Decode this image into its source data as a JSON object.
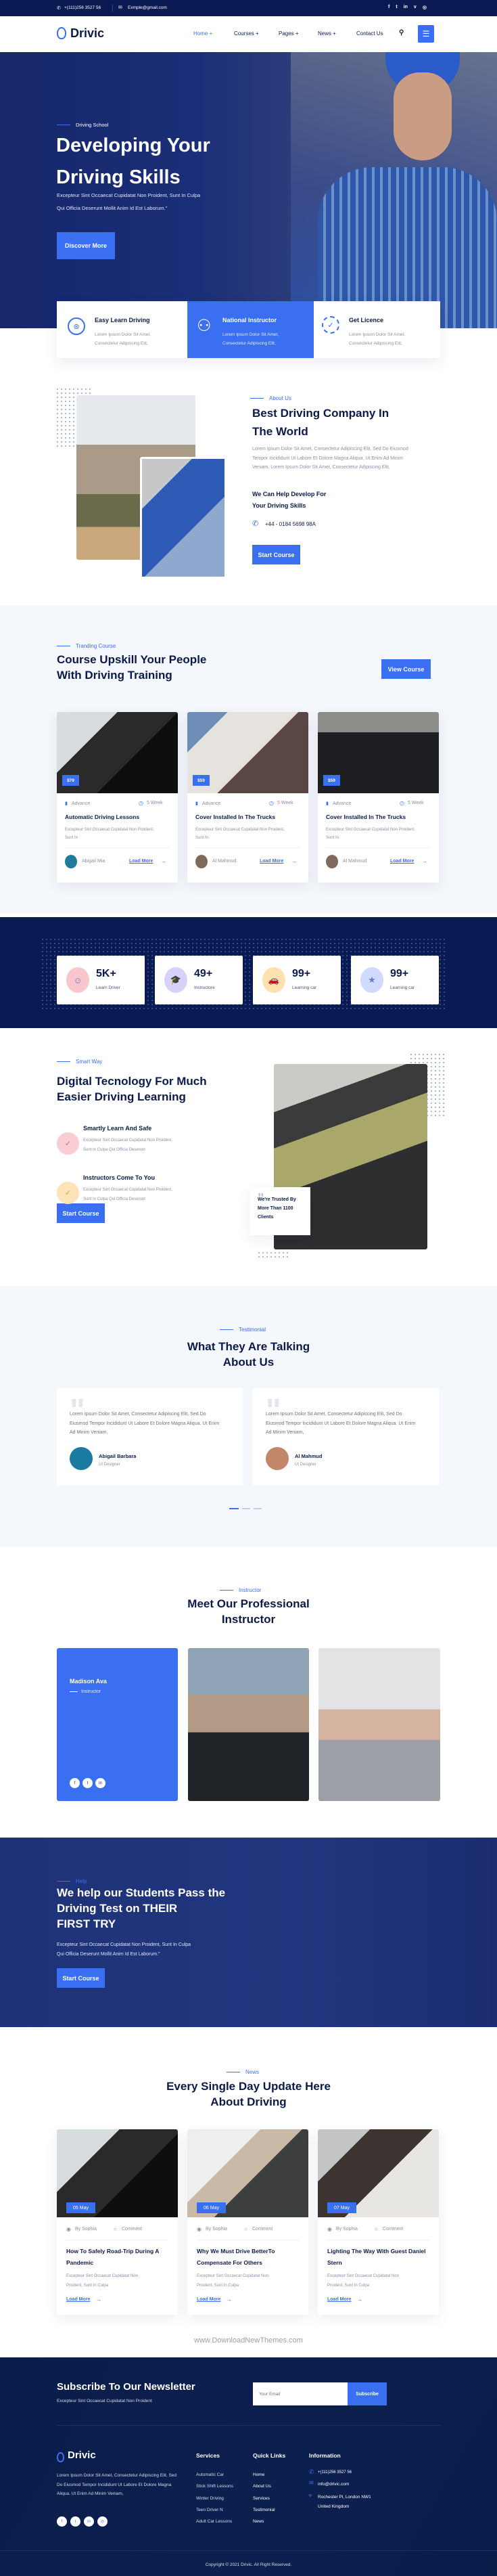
{
  "topbar": {
    "phone": "+(111)256 3527 56",
    "email": "Exmple@gmail.com",
    "social_icons": [
      "facebook-icon",
      "twitter-icon",
      "linkedin-icon",
      "vimeo-icon",
      "instagram-icon"
    ]
  },
  "nav": {
    "logo": "Drivic",
    "items": [
      "Home +",
      "Courses +",
      "Pages +",
      "News +",
      "Contact Us"
    ],
    "active_index": 0
  },
  "hero": {
    "eyebrow": "Driving School",
    "title_line1": "Developing Your",
    "title_line2": "Driving Skills",
    "text_line1": "Excepteur Sint Occaecat Cupidatat Non Proident, Sunt In Culpa",
    "text_line2": "Qui Officia Deserunt Mollit Anim Id Est Laborum.\"",
    "button": "Discover More"
  },
  "features": [
    {
      "title": "Easy Learn Driving",
      "text1": "Lorem Ipsum Dolor Sit Amet,",
      "text2": "Consectetur Adipiscing Elit,",
      "icon": "steering-wheel-icon"
    },
    {
      "title": "National Instructor",
      "text1": "Lorem Ipsum Dolor Sit Amet,",
      "text2": "Consectetur Adipiscing Elit,",
      "icon": "instructor-icon"
    },
    {
      "title": "Get Licence",
      "text1": "Lorem Ipsum Dolor Sit Amet,",
      "text2": "Consectetur Adipiscing Elit,",
      "icon": "badge-check-icon"
    }
  ],
  "about": {
    "eyebrow": "About Us",
    "title_line1": "Best Driving Company In",
    "title_line2": "The World",
    "text": "Lorem Ipsum Dolor Sit Amet, Consectetur Adipiscing Elit, Sed Do Eiusmod Tempor Incididunt Ut Labore Et Dolore Magna Aliqua. Ut Enim Ad Minim Veniam, Lorem Ipsum Dolor Sit Amet, Consectetur Adipiscing Elit,",
    "subtitle_line1": "We Can Help Develop For",
    "subtitle_line2": "Your Driving Skills",
    "phone": "+44 - 0184 5698 98A",
    "button": "Start Course"
  },
  "courses": {
    "eyebrow": "Tranding Course",
    "title_line1": "Course Upskill Your People",
    "title_line2": "With Driving Training",
    "button": "View Course",
    "items": [
      {
        "price": "$79",
        "level": "Advance",
        "duration": "5 Week",
        "title": "Automatic Driving Lessons",
        "text": "Excepteur Sint Occaecat Cupidatat Non Proident, Sunt In",
        "author": "Abigail Mia",
        "link": "Load More"
      },
      {
        "price": "$59",
        "level": "Advance",
        "duration": "5 Week",
        "title": "Cover Installed In The Trucks",
        "text": "Excepteur Sint Occaecat Cupidatat Non Proident, Sunt In",
        "author": "Al Mahmud",
        "link": "Load More"
      },
      {
        "price": "$59",
        "level": "Advance",
        "duration": "5 Week",
        "title": "Cover Installed In The Trucks",
        "text": "Excepteur Sint Occaecat Cupidatat Non Proident, Sunt In",
        "author": "Al Mahmud",
        "link": "Load More"
      }
    ]
  },
  "stats": [
    {
      "value": "5K+",
      "label": "Learn Driver",
      "color": "#f8c6cc",
      "icon": "driver-icon"
    },
    {
      "value": "49+",
      "label": "Instructore",
      "color": "#d6d2fb",
      "icon": "graduation-cap-icon"
    },
    {
      "value": "99+",
      "label": "Learning car",
      "color": "#fde2b0",
      "icon": "car-icon"
    },
    {
      "value": "99+",
      "label": "Learning car",
      "color": "#cfdafd",
      "icon": "trophy-icon"
    }
  ],
  "smart": {
    "eyebrow": "Smart Way",
    "title_line1": "Digital Tecnology For Much",
    "title_line2": "Easier Driving Learning",
    "items": [
      {
        "title": "Smartly Learn And Safe",
        "text1": "Excepteur Sint Occaecat Cupidatat Non Proident,",
        "text2": "Sunt In Culpa Qui Officia Deserunt",
        "color": "#f9cdd3",
        "icon_color": "#e06b7d"
      },
      {
        "title": "Instructors Come To You",
        "text1": "Excepteur Sint Occaecat Cupidatat Non Proident,",
        "text2": "Sunt In Culpa Qui Officia Deserunt",
        "color": "#fde3b8",
        "icon_color": "#e7a53d"
      }
    ],
    "button": "Start Course",
    "trust_line1": "We're Trusted By",
    "trust_line2": "More Than 1100",
    "trust_line3": "Clients"
  },
  "testimonials": {
    "eyebrow": "Testimonial",
    "title_line1": "What They Are Talking",
    "title_line2": "About Us",
    "items": [
      {
        "text": "Lorem Ipsum Dolor Sit Amet, Consectetur Adipiscing Elit, Sed Do Eiusmod Tempor Incididunt Ut Labore Et Dolore Magna Aliqua. Ut Enim Ad Minim Veniam,",
        "name": "Abigail Barbara",
        "role": "UI Designer"
      },
      {
        "text": "Lorem Ipsum Dolor Sit Amet, Consectetur Adipiscing Elit, Sed Do Eiusmod Tempor Incididunt Ut Labore Et Dolore Magna Aliqua. Ut Enim Ad Minim Veniam,",
        "name": "Al Mahmud",
        "role": "UI Designer"
      }
    ],
    "active_dot": 0
  },
  "instructors": {
    "eyebrow": "Instructor",
    "title_line1": "Meet Our Professional",
    "title_line2": "Instructor",
    "featured_name": "Madison Ava",
    "featured_role": "Instructor"
  },
  "help": {
    "eyebrow": "Help",
    "title_line1": "We help our Students Pass the",
    "title_line2": "Driving Test on THEIR",
    "title_line3": "FIRST TRY",
    "text_line1": "Excepteur Sint Occaecat Cupidatat Non Proident, Sunt In Culpa",
    "text_line2": "Qui Officia Deserunt Mollit Anim Id Est Laborum.\"",
    "button": "Start Course"
  },
  "news": {
    "eyebrow": "News",
    "title_line1": "Every Single Day Update Here",
    "title_line2": "About Driving",
    "items": [
      {
        "date": "05 May",
        "author": "By Sophia",
        "comment": "Comment",
        "title": "How To Safely Road-Trip During A Pandemic",
        "text": "Excepteur Sint Occaecat Cupidatat Non Proident, Sunt In Culpa",
        "link": "Load More"
      },
      {
        "date": "06 May",
        "author": "By Sophia",
        "comment": "Comment",
        "title": "Why We Must Drive BetterTo Compensate For Others",
        "text": "Excepteur Sint Occaecat Cupidatat Non Proident, Sunt In Culpa",
        "link": "Load More"
      },
      {
        "date": "07 May",
        "author": "By Sophia",
        "comment": "Comment",
        "title": "Lighting The Way With Guest Daniel Stern",
        "text": "Excepteur Sint Occaecat Cupidatat Non Proident, Sunt In Culpa",
        "link": "Load More"
      }
    ]
  },
  "watermark": "www.DownloadNewThemes.com",
  "newsletter": {
    "title": "Subscribe To Our Newsletter",
    "text": "Excepteur Sint Occaecat Cupidatat Non Proident",
    "placeholder": "Your Email",
    "button": "Subscribe"
  },
  "footer": {
    "logo": "Drivic",
    "about": "Lorem Ipsum Dolor Sit Amet, Consectetur Adipiscing Elit, Sed Do Eiusmod Tempor Incididunt Ut Labore Et Dolore Magna Aliqua. Ut Enim Ad Minim Veniam,",
    "services_title": "Services",
    "services": [
      "Automatic Car",
      "Stick Shift Lessons",
      "Winter Driving",
      "Teen Driver N",
      "Adult Car Lessons"
    ],
    "links_title": "Quick Links",
    "links": [
      "Home",
      "About Us",
      "Services",
      "Testimonial",
      "News"
    ],
    "info_title": "Information",
    "info_phone": "+(111)256 3527 56",
    "info_email": "info@drivic.com",
    "info_address_line1": "Rochester Pl, London NW1",
    "info_address_line2": "United Kingdom",
    "copyright": "Copyright © 2021 Drivic. All Right Reserved."
  },
  "colors": {
    "primary": "#3b6ff2",
    "navy": "#0b1a4b",
    "dark": "#0a1a52"
  }
}
